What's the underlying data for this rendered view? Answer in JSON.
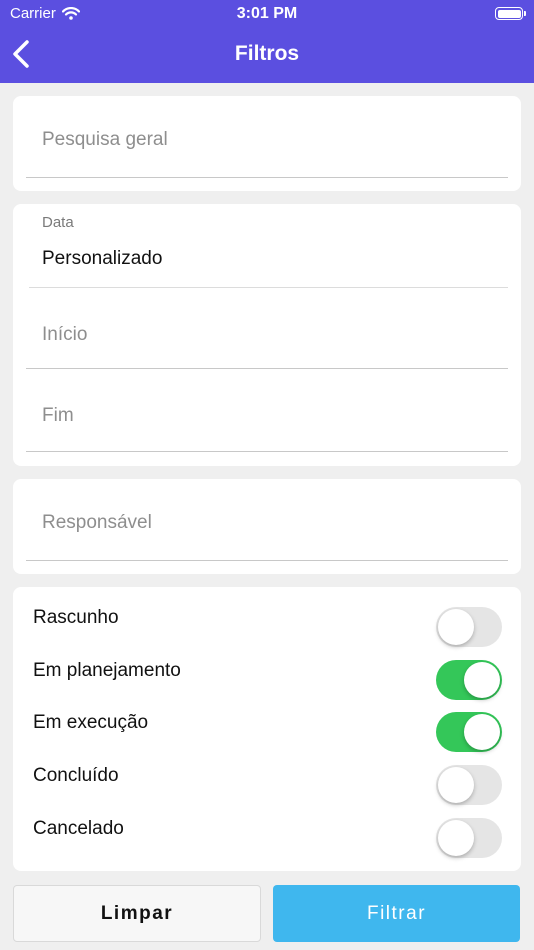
{
  "status": {
    "carrier": "Carrier",
    "time": "3:01 PM"
  },
  "header": {
    "title": "Filtros"
  },
  "search": {
    "placeholder": "Pesquisa geral"
  },
  "date": {
    "label": "Data",
    "value": "Personalizado",
    "start_placeholder": "Início",
    "end_placeholder": "Fim"
  },
  "responsible": {
    "placeholder": "Responsável"
  },
  "statuses": [
    {
      "label": "Rascunho",
      "on": false
    },
    {
      "label": "Em planejamento",
      "on": true
    },
    {
      "label": "Em execução",
      "on": true
    },
    {
      "label": "Concluído",
      "on": false
    },
    {
      "label": "Cancelado",
      "on": false
    }
  ],
  "buttons": {
    "clear": "Limpar",
    "filter": "Filtrar"
  },
  "colors": {
    "header": "#5b4fe0",
    "switch_on": "#34c759",
    "filter_button": "#3fb7ee"
  }
}
